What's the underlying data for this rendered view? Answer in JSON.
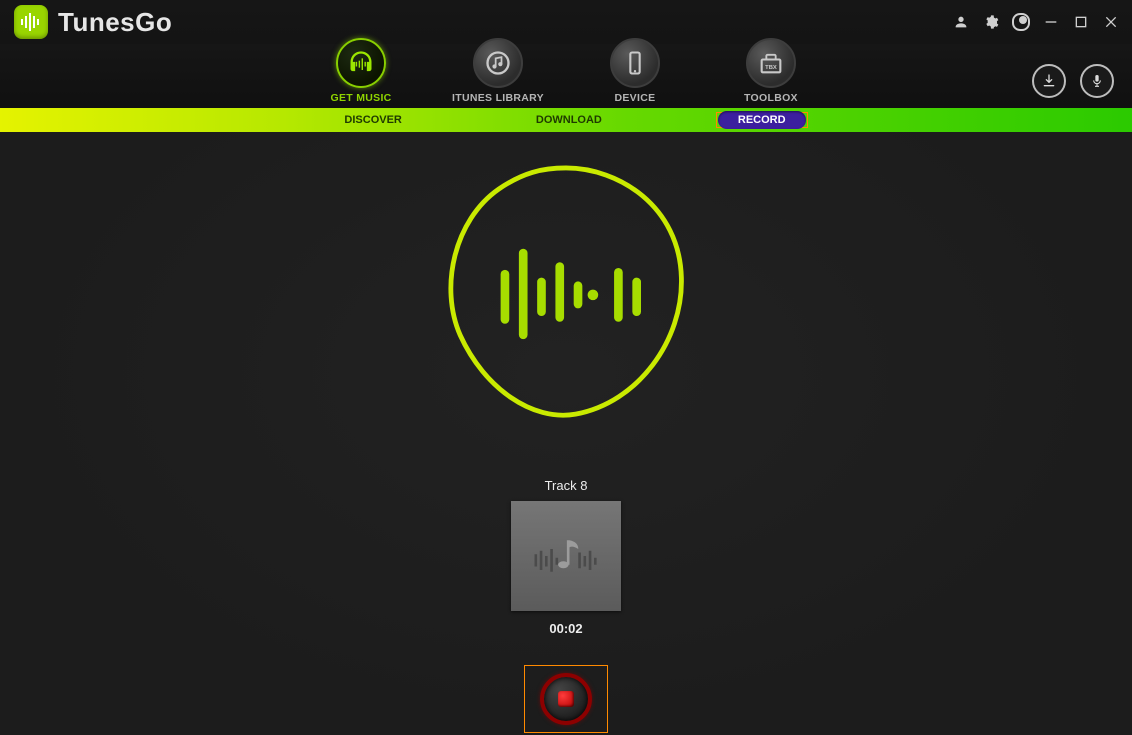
{
  "app": {
    "title": "TunesGo"
  },
  "titlebar_icons": {
    "user": "user-icon",
    "settings": "gear-icon",
    "toggle": "toggle-icon",
    "minimize": "minimize-icon",
    "maximize": "maximize-icon",
    "close": "close-icon"
  },
  "nav": [
    {
      "id": "get-music",
      "label": "GET MUSIC",
      "icon": "headphones-icon",
      "active": true
    },
    {
      "id": "itunes-library",
      "label": "ITUNES LIBRARY",
      "icon": "music-note-icon",
      "active": false
    },
    {
      "id": "device",
      "label": "DEVICE",
      "icon": "phone-icon",
      "active": false
    },
    {
      "id": "toolbox",
      "label": "TOOLBOX",
      "icon": "toolbox-icon",
      "active": false
    }
  ],
  "nav_right": {
    "download": "download-icon",
    "microphone": "microphone-icon"
  },
  "sub_tabs": [
    {
      "id": "discover",
      "label": "DISCOVER",
      "active": false,
      "highlight": false
    },
    {
      "id": "download",
      "label": "DOWNLOAD",
      "active": false,
      "highlight": false
    },
    {
      "id": "record",
      "label": "RECORD",
      "active": true,
      "highlight": true
    }
  ],
  "recording": {
    "track_label": "Track 8",
    "elapsed": "00:02"
  },
  "colors": {
    "accent": "#8fd400",
    "highlight_border": "#ff8a00",
    "active_pill": "#3c1f9f",
    "stop_red": "#b40000"
  }
}
